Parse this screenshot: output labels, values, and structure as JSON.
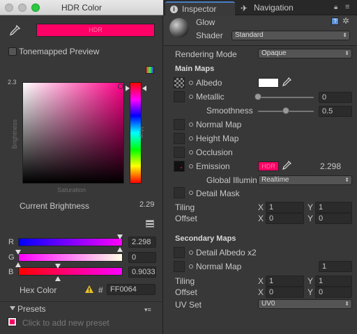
{
  "colors": {
    "hdr_color": "#ff0066",
    "accent": "#4a7ec7",
    "mac_green": "#2cc840",
    "mac_inactive": "#bdbdbd"
  },
  "hdr_window": {
    "title": "HDR Color",
    "swatch_text": "HDR",
    "eyedropper_icon": "eyedropper-icon",
    "tonemapped_preview_label": "Tonemapped Preview",
    "tonemapped_preview_checked": false,
    "brightness_max": "2.3",
    "brightness_axis_label": "Brightness",
    "saturation_axis_label": "Saturation",
    "hue_axis_label": "Hue",
    "current_brightness_label": "Current Brightness",
    "current_brightness_value": "2.29",
    "channels": [
      {
        "name": "R",
        "value": "2.298",
        "level": 0.97
      },
      {
        "name": "G",
        "value": "0",
        "level": 0.0
      },
      {
        "name": "B",
        "value": "0.9033",
        "level": 0.38
      }
    ],
    "hex_label": "Hex Color",
    "hex_prefix": "#",
    "hex_value": "FF0064",
    "warning_icon": "warning-icon",
    "presets_label": "Presets",
    "presets_hint": "Click to add new preset"
  },
  "inspector": {
    "tabs": [
      {
        "label": "Inspector",
        "icon": "info-icon"
      },
      {
        "label": "Navigation",
        "icon": "navigation-icon"
      }
    ],
    "material_name": "Glow",
    "shader_label": "Shader",
    "shader_value": "Standard",
    "rendering_mode_label": "Rendering Mode",
    "rendering_mode_value": "Opaque",
    "main_maps_title": "Main Maps",
    "albedo_label": "Albedo",
    "metallic_label": "Metallic",
    "metallic_value": "0",
    "metallic_level": 0.0,
    "smoothness_label": "Smoothness",
    "smoothness_value": "0.5",
    "smoothness_level": 0.5,
    "normal_map_label": "Normal Map",
    "height_map_label": "Height Map",
    "occlusion_label": "Occlusion",
    "emission_label": "Emission",
    "emission_swatch_text": "HDR",
    "emission_value": "2.298",
    "global_illum_label": "Global Illumin",
    "global_illum_value": "Realtime",
    "detail_mask_label": "Detail Mask",
    "tiling_label": "Tiling",
    "offset_label": "Offset",
    "x_label": "X",
    "y_label": "Y",
    "main_tiling_x": "1",
    "main_tiling_y": "1",
    "main_offset_x": "0",
    "main_offset_y": "0",
    "secondary_maps_title": "Secondary Maps",
    "detail_albedo_label": "Detail Albedo x2",
    "sec_normal_map_label": "Normal Map",
    "sec_normal_value": "1",
    "sec_tiling_x": "1",
    "sec_tiling_y": "1",
    "sec_offset_x": "0",
    "sec_offset_y": "0",
    "uv_set_label": "UV Set",
    "uv_set_value": "UV0"
  }
}
